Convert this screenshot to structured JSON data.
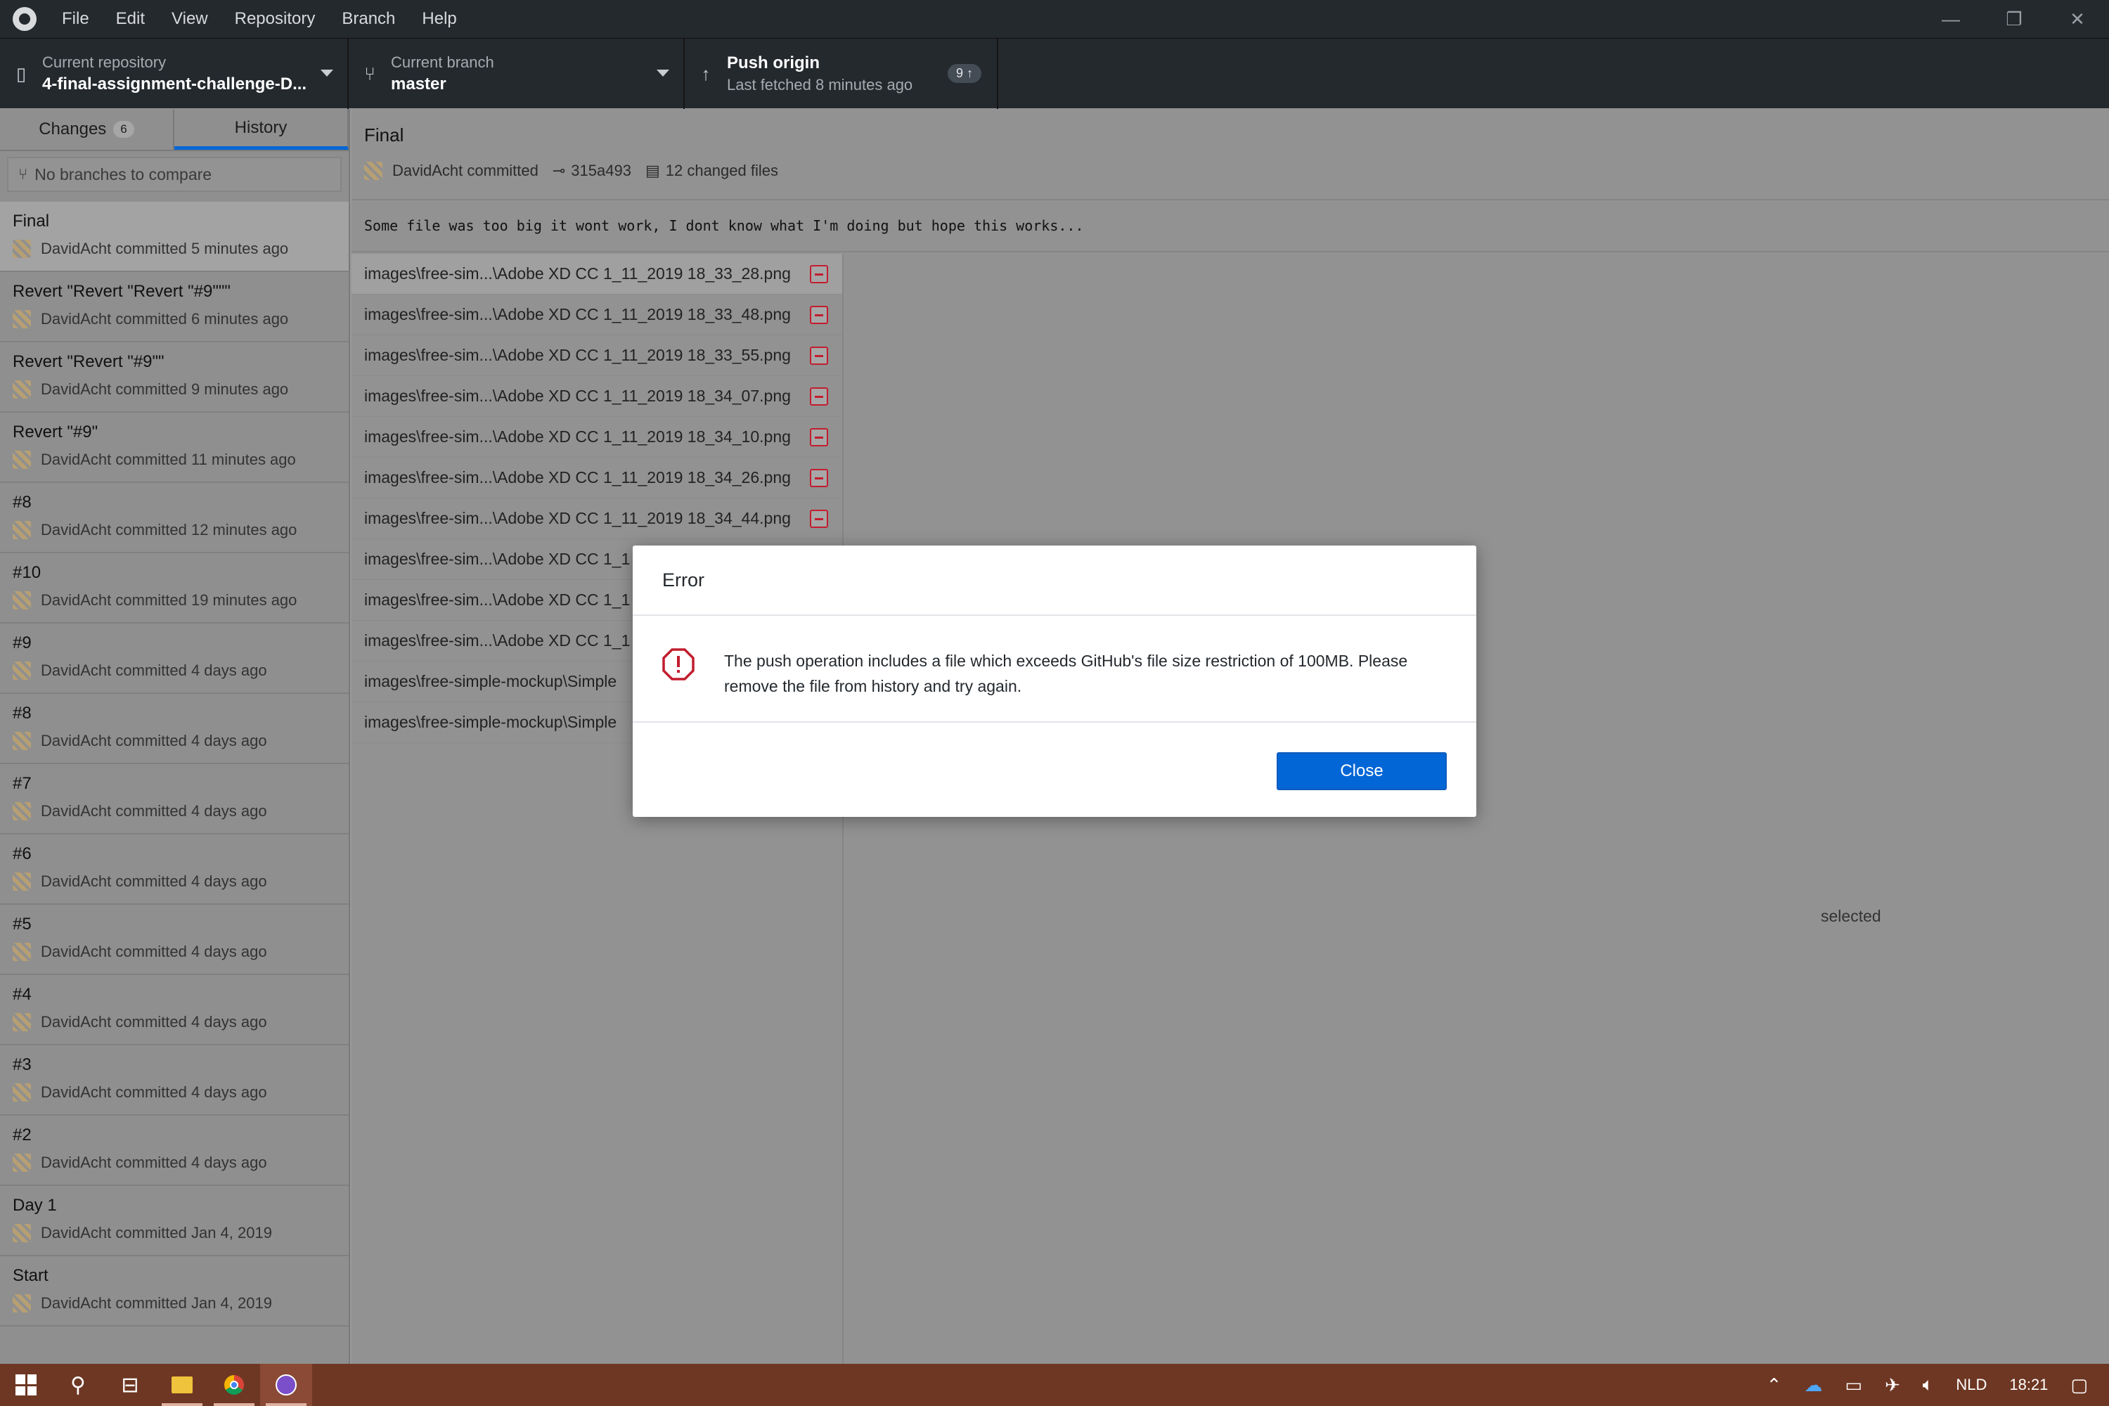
{
  "menu": [
    "File",
    "Edit",
    "View",
    "Repository",
    "Branch",
    "Help"
  ],
  "toolbar": {
    "repo_label": "Current repository",
    "repo_value": "4-final-assignment-challenge-D...",
    "branch_label": "Current branch",
    "branch_value": "master",
    "push_label": "Push origin",
    "push_sub": "Last fetched 8 minutes ago",
    "push_badge": "9 ↑"
  },
  "sidebar": {
    "tab_changes": "Changes",
    "tab_changes_count": "6",
    "tab_history": "History",
    "compare_placeholder": "No branches to compare",
    "commits": [
      {
        "title": "Final",
        "meta": "DavidAcht committed 5 minutes ago"
      },
      {
        "title": "Revert \"Revert \"Revert \"#9\"\"\"",
        "meta": "DavidAcht committed 6 minutes ago"
      },
      {
        "title": "Revert \"Revert \"#9\"\"",
        "meta": "DavidAcht committed 9 minutes ago"
      },
      {
        "title": "Revert \"#9\"",
        "meta": "DavidAcht committed 11 minutes ago"
      },
      {
        "title": "#8",
        "meta": "DavidAcht committed 12 minutes ago"
      },
      {
        "title": "#10",
        "meta": "DavidAcht committed 19 minutes ago"
      },
      {
        "title": "#9",
        "meta": "DavidAcht committed 4 days ago"
      },
      {
        "title": "#8",
        "meta": "DavidAcht committed 4 days ago"
      },
      {
        "title": "#7",
        "meta": "DavidAcht committed 4 days ago"
      },
      {
        "title": "#6",
        "meta": "DavidAcht committed 4 days ago"
      },
      {
        "title": "#5",
        "meta": "DavidAcht committed 4 days ago"
      },
      {
        "title": "#4",
        "meta": "DavidAcht committed 4 days ago"
      },
      {
        "title": "#3",
        "meta": "DavidAcht committed 4 days ago"
      },
      {
        "title": "#2",
        "meta": "DavidAcht committed 4 days ago"
      },
      {
        "title": "Day 1",
        "meta": "DavidAcht committed Jan 4, 2019"
      },
      {
        "title": "Start",
        "meta": "DavidAcht committed Jan 4, 2019"
      }
    ]
  },
  "commit": {
    "title": "Final",
    "author": "DavidAcht committed",
    "sha": "315a493",
    "changed": "12 changed files",
    "description": "Some file was too big it wont work, I dont know what I'm doing but hope this works..."
  },
  "files": [
    "images\\free-sim...\\Adobe XD CC 1_11_2019 18_33_28.png",
    "images\\free-sim...\\Adobe XD CC 1_11_2019 18_33_48.png",
    "images\\free-sim...\\Adobe XD CC 1_11_2019 18_33_55.png",
    "images\\free-sim...\\Adobe XD CC 1_11_2019 18_34_07.png",
    "images\\free-sim...\\Adobe XD CC 1_11_2019 18_34_10.png",
    "images\\free-sim...\\Adobe XD CC 1_11_2019 18_34_26.png",
    "images\\free-sim...\\Adobe XD CC 1_11_2019 18_34_44.png",
    "images\\free-sim...\\Adobe XD CC 1_1",
    "images\\free-sim...\\Adobe XD CC 1_1",
    "images\\free-sim...\\Adobe XD CC 1_1",
    "images\\free-simple-mockup\\Simple",
    "images\\free-simple-mockup\\Simple"
  ],
  "no_selection_text": "selected",
  "modal": {
    "title": "Error",
    "message": "The push operation includes a file which exceeds GitHub's file size restriction of 100MB. Please remove the file from history and try again.",
    "close_label": "Close"
  },
  "taskbar": {
    "lang": "NLD",
    "time": "18:21"
  },
  "colors": {
    "accent": "#0366d6",
    "error": "#c21d2f",
    "titlebar": "#24292e",
    "taskbar": "#6e3723"
  }
}
